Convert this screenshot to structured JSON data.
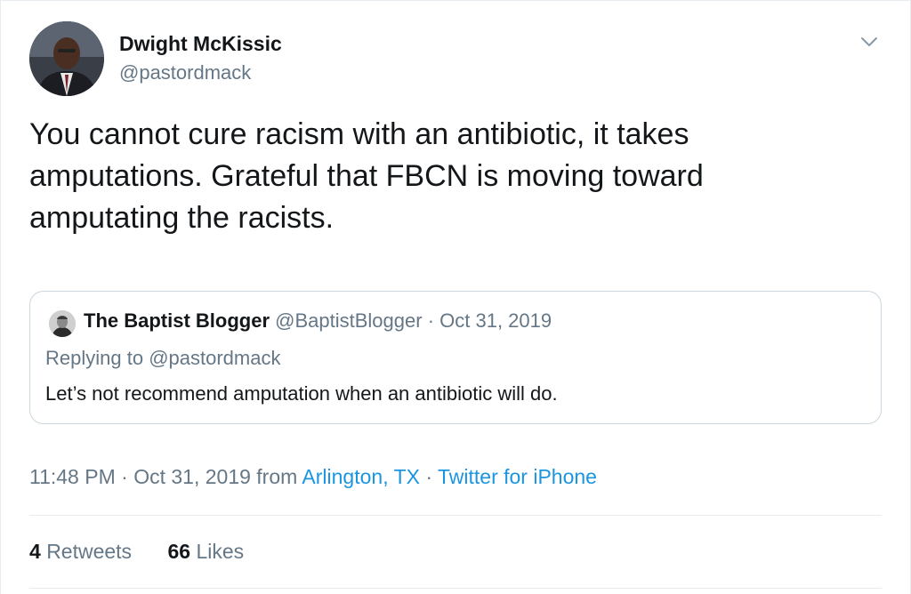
{
  "tweet": {
    "author": {
      "name": "Dwight McKissic",
      "handle": "@pastordmack"
    },
    "text": "You cannot cure racism with an antibiotic, it takes amputations. Grateful that FBCN is moving toward amputating the racists.",
    "quoted": {
      "name": "The Baptist Blogger",
      "handle": "@BaptistBlogger",
      "separator": "·",
      "date": "Oct 31, 2019",
      "replying_prefix": "Replying to",
      "replying_handle": "@pastordmack",
      "text": "Let’s not recommend amputation when an antibiotic will do."
    },
    "meta": {
      "time": "11:48 PM",
      "separator": "·",
      "date": "Oct 31, 2019",
      "from_label": "from",
      "location": "Arlington, TX",
      "source": "Twitter for iPhone"
    },
    "stats": {
      "retweets_count": "4",
      "retweets_label": "Retweets",
      "likes_count": "66",
      "likes_label": "Likes"
    }
  },
  "icons": {
    "menu": "chevron-down-icon"
  },
  "colors": {
    "link": "#1b95e0",
    "secondary_text": "#657786",
    "primary_text": "#14171a",
    "border": "#ccd6dd"
  }
}
